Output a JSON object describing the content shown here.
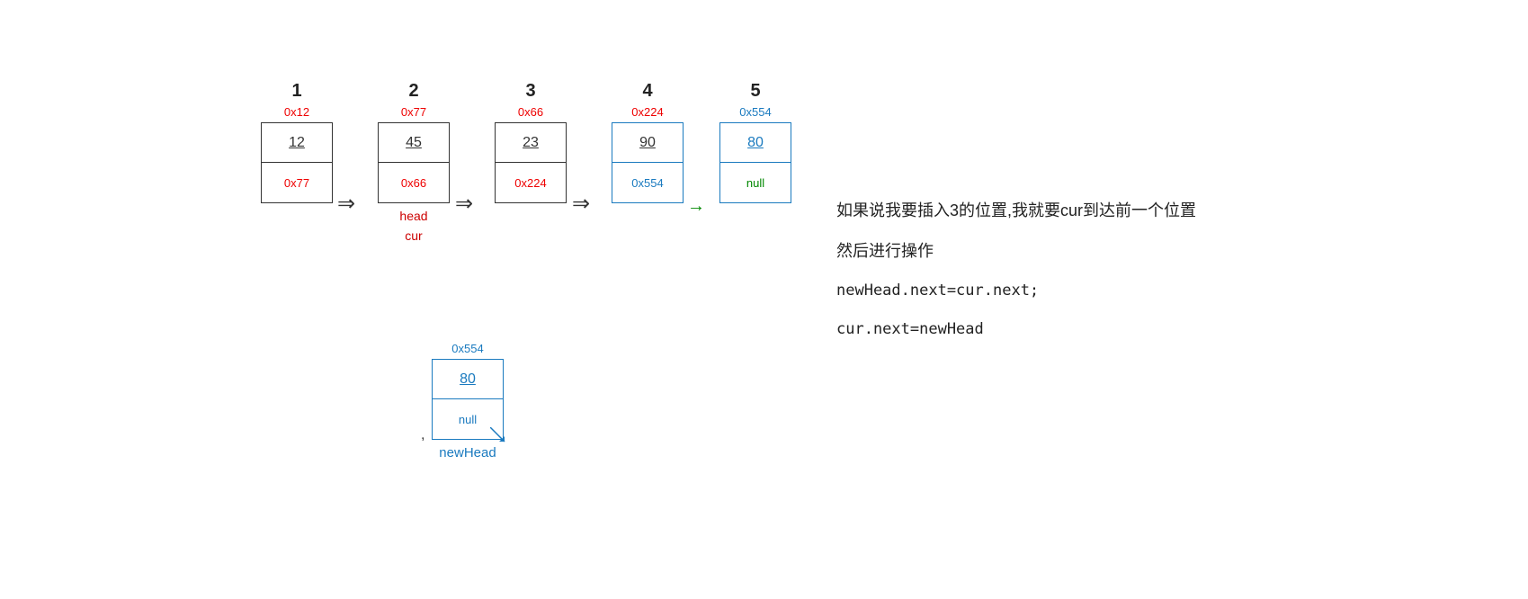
{
  "nodes": [
    {
      "id": "node1",
      "index": "1",
      "address": "0x12",
      "data": "12",
      "next": "0x77",
      "addressColor": "red",
      "nextColor": "red",
      "borderColor": "normal"
    },
    {
      "id": "node2",
      "index": "2",
      "address": "0x77",
      "data": "45",
      "next": "0x66",
      "addressColor": "red",
      "nextColor": "red",
      "borderColor": "normal"
    },
    {
      "id": "node3",
      "index": "3",
      "address": "0x66",
      "data": "23",
      "next": "0x224",
      "addressColor": "red",
      "nextColor": "red",
      "borderColor": "normal"
    },
    {
      "id": "node4",
      "index": "4",
      "address": "0x224",
      "data": "90",
      "next": "0x554",
      "addressColor": "red",
      "nextColor": "blue",
      "borderColor": "blue"
    },
    {
      "id": "node5",
      "index": "5",
      "address": "0x554",
      "data": "80",
      "next": "null",
      "addressColor": "blue",
      "nextColor": "green",
      "borderColor": "blue"
    }
  ],
  "labels": {
    "head": "head",
    "cur": "cur"
  },
  "arrows": [
    "⇒",
    "⇒",
    "⇒",
    "→"
  ],
  "bottomNode": {
    "address": "0x554",
    "data": "80",
    "next": "null",
    "label": "newHead",
    "comma": ","
  },
  "textPanel": {
    "line1": "如果说我要插入3的位置,我就要cur到达前一个位置",
    "line2": "然后进行操作",
    "line3": "newHead.next=cur.next;",
    "line4": "cur.next=newHead"
  }
}
